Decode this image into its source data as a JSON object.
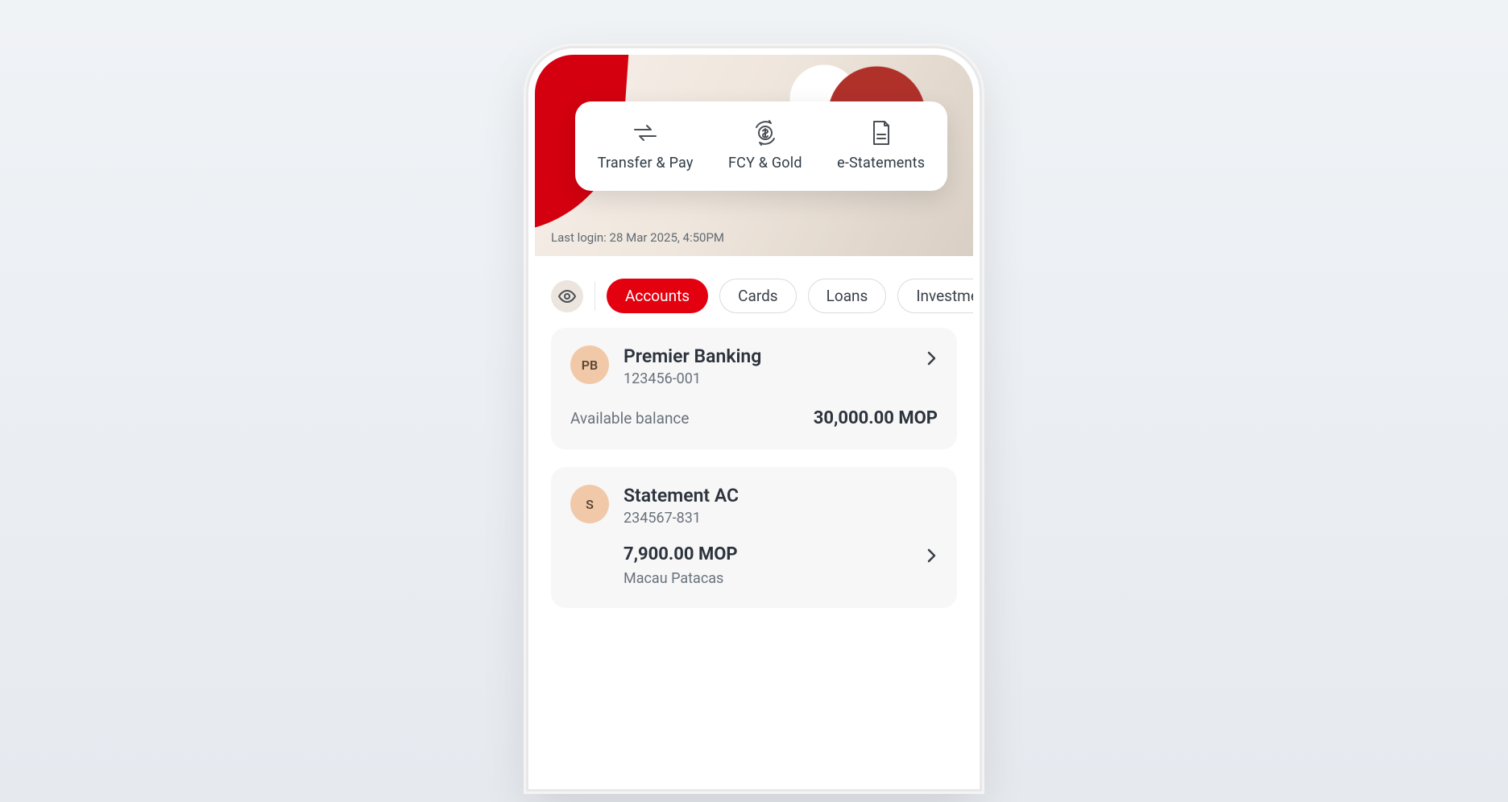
{
  "quick": {
    "items": [
      {
        "label": "Transfer & Pay"
      },
      {
        "label": "FCY & Gold"
      },
      {
        "label": "e-Statements"
      }
    ]
  },
  "last_login": "Last login: 28 Mar 2025, 4:50PM",
  "tabs": {
    "items": [
      {
        "label": "Accounts"
      },
      {
        "label": "Cards"
      },
      {
        "label": "Loans"
      },
      {
        "label": "Investments"
      }
    ]
  },
  "accounts": [
    {
      "avatar": "PB",
      "name": "Premier Banking",
      "number": "123456-001",
      "balance_label": "Available balance",
      "balance": "30,000.00 MOP"
    },
    {
      "avatar": "S",
      "name": "Statement AC",
      "number": "234567-831",
      "amount": "7,900.00 MOP",
      "currency_name": "Macau Patacas"
    }
  ]
}
